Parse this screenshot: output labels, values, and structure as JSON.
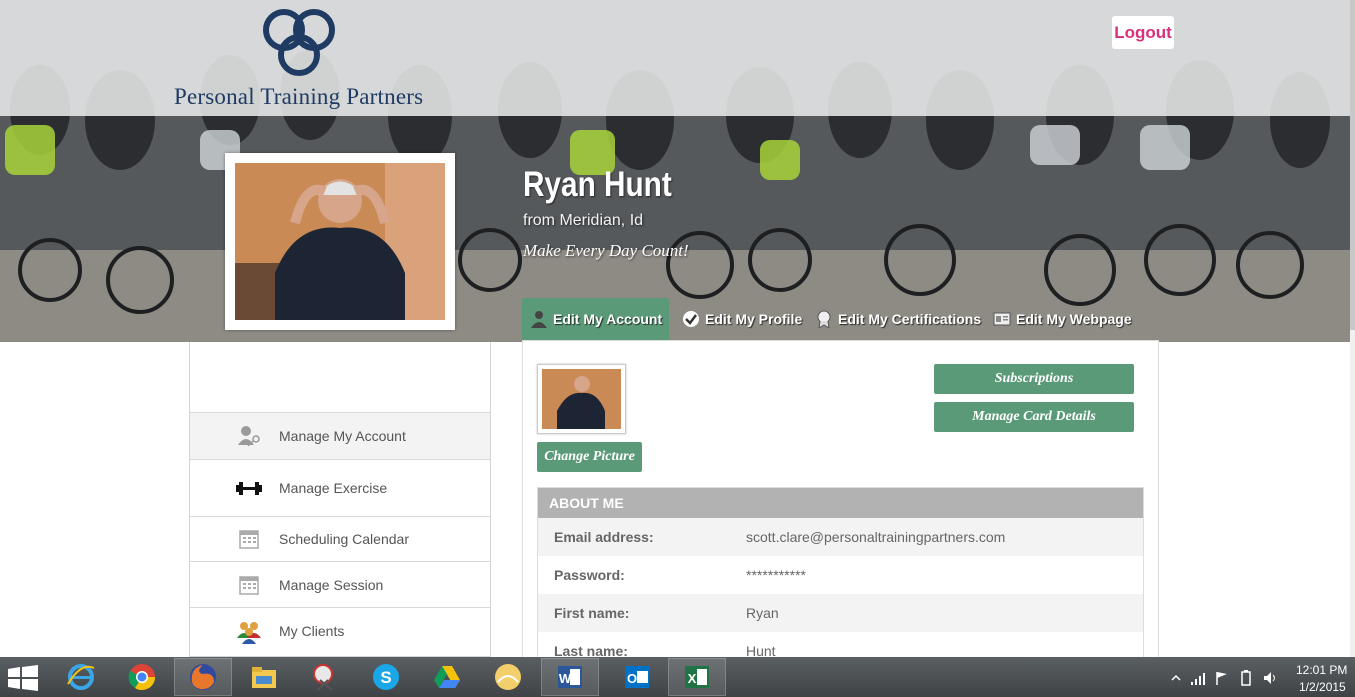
{
  "brand": {
    "logo_text": "Personal Training Partners",
    "ring_color": "#1f3b63"
  },
  "header": {
    "logout_label": "Logout"
  },
  "profile": {
    "name": "Ryan Hunt",
    "location": "from Meridian, Id",
    "motto": "Make Every Day Count!"
  },
  "tabs": [
    {
      "label": "Edit My Account",
      "icon": "user-silhouette-icon",
      "active": true
    },
    {
      "label": "Edit My Profile",
      "icon": "checkmark-circle-icon",
      "active": false
    },
    {
      "label": "Edit My Certifications",
      "icon": "award-ribbon-icon",
      "active": false
    },
    {
      "label": "Edit My Webpage",
      "icon": "id-card-icon",
      "active": false
    }
  ],
  "sidebar": {
    "items": [
      {
        "label": "Manage My Account",
        "icon": "user-key-icon"
      },
      {
        "label": "Manage Exercise",
        "icon": "dumbbell-icon"
      },
      {
        "label": "Scheduling Calendar",
        "icon": "calendar-icon"
      },
      {
        "label": "Manage Session",
        "icon": "calendar-icon"
      },
      {
        "label": "My Clients",
        "icon": "people-group-icon"
      }
    ]
  },
  "main": {
    "change_picture_label": "Change Picture",
    "subscriptions_label": "Subscriptions",
    "manage_card_label": "Manage Card Details",
    "about": {
      "title": "ABOUT ME",
      "rows": [
        {
          "label": "Email address:",
          "value": "scott.clare@personaltrainingpartners.com"
        },
        {
          "label": "Password:",
          "value": "***********"
        },
        {
          "label": "First name:",
          "value": "Ryan"
        },
        {
          "label": "Last name:",
          "value": "Hunt"
        }
      ]
    }
  },
  "colors": {
    "accent_green": "#5b9a78",
    "logout_pink": "#d8307a",
    "header_gray": "#b2b2b2"
  },
  "taskbar": {
    "apps": [
      "internet-explorer-icon",
      "chrome-icon",
      "firefox-icon",
      "file-explorer-icon",
      "snipping-tool-icon",
      "skype-icon",
      "google-drive-icon",
      "photo-app-icon",
      "word-icon",
      "outlook-icon",
      "excel-icon"
    ],
    "clock_time": "12:01 PM",
    "clock_date": "1/2/2015"
  }
}
